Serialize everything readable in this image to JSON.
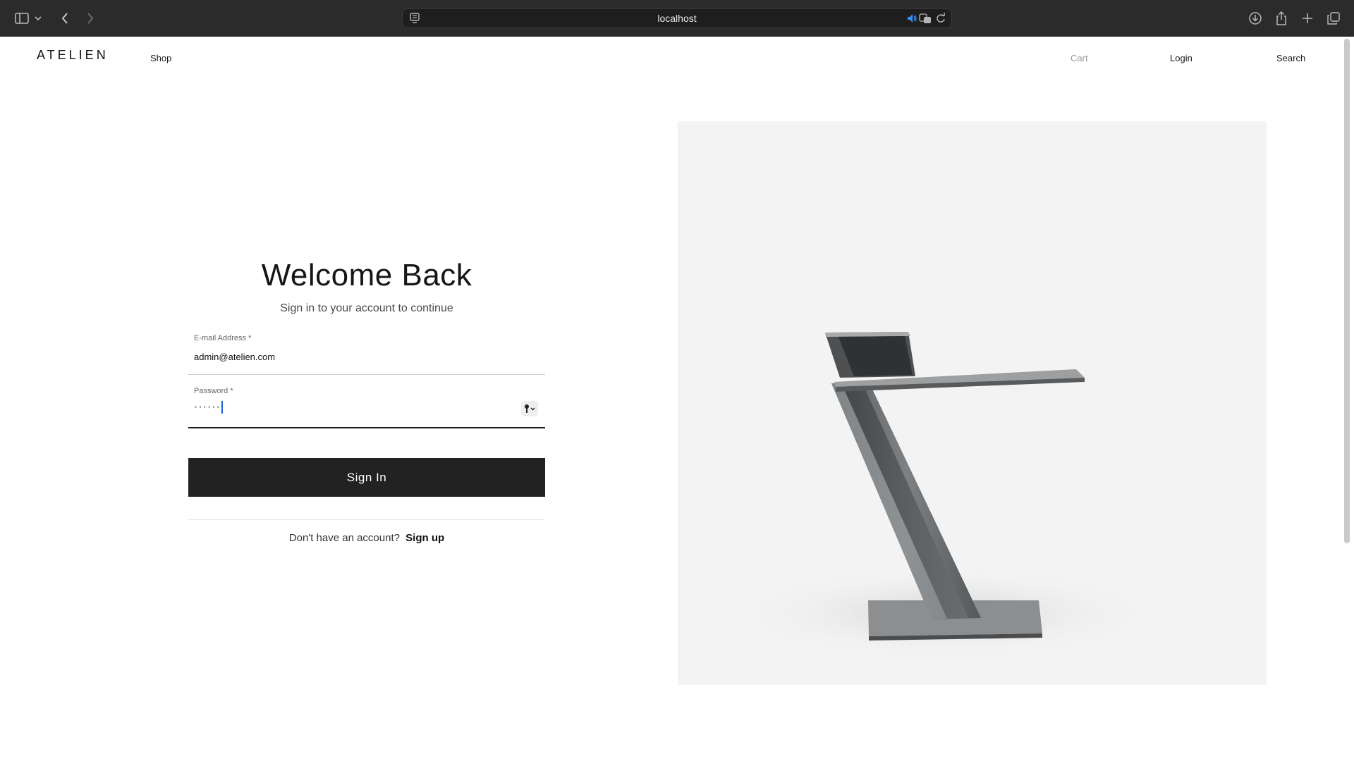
{
  "browser": {
    "url": "localhost",
    "icons": [
      "sidebar-icon",
      "chevron-down-icon",
      "back-icon",
      "forward-icon",
      "reader-icon",
      "speaker-icon",
      "translate-icon",
      "reload-icon",
      "download-icon",
      "share-icon",
      "new-tab-icon",
      "tabs-overview-icon"
    ]
  },
  "site": {
    "logo": "ATELIEN",
    "nav": {
      "shop": "Shop",
      "cart": "Cart",
      "login": "Login",
      "search": "Search"
    }
  },
  "login": {
    "title": "Welcome Back",
    "subtitle": "Sign in to your account to continue",
    "email_label": "E-mail Address *",
    "email_value": "admin@atelien.com",
    "password_label": "Password *",
    "password_value": "······",
    "submit_label": "Sign In",
    "signup_prompt": "Don't have an account?",
    "signup_link": "Sign up"
  },
  "colors": {
    "button": "#222222",
    "chrome": "#2b2b2b",
    "hero_bg": "#f3f3f3"
  }
}
